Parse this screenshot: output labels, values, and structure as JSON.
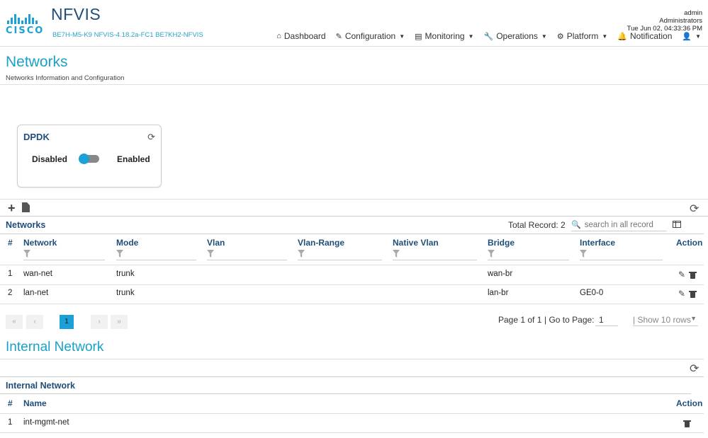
{
  "brand": {
    "logo_text": "cisco",
    "app_title": "NFVIS",
    "app_subtitle": "BE7H-M5-K9 NFVIS-4.18.2a-FC1 BE7KH2-NFVIS"
  },
  "user": {
    "name": "admin",
    "role": "Administrators",
    "datetime": "Tue Jun 02, 04:33:36 PM"
  },
  "nav": {
    "dashboard": "Dashboard",
    "configuration": "Configuration",
    "monitoring": "Monitoring",
    "operations": "Operations",
    "platform": "Platform",
    "notification": "Notification"
  },
  "page": {
    "title": "Networks",
    "description": "Networks Information and Configuration"
  },
  "dpdk": {
    "title": "DPDK",
    "disabled_label": "Disabled",
    "enabled_label": "Enabled",
    "state": "Disabled"
  },
  "networks": {
    "title": "Networks",
    "total_record": "Total Record: 2",
    "search_placeholder": "search in all record",
    "columns": {
      "num": "#",
      "network": "Network",
      "mode": "Mode",
      "vlan": "Vlan",
      "vlan_range": "Vlan-Range",
      "native_vlan": "Native Vlan",
      "bridge": "Bridge",
      "interface": "Interface",
      "action": "Action"
    },
    "rows": [
      {
        "num": "1",
        "network": "wan-net",
        "mode": "trunk",
        "vlan": "",
        "vlan_range": "",
        "native_vlan": "",
        "bridge": "wan-br",
        "interface": ""
      },
      {
        "num": "2",
        "network": "lan-net",
        "mode": "trunk",
        "vlan": "",
        "vlan_range": "",
        "native_vlan": "",
        "bridge": "lan-br",
        "interface": "GE0-0"
      }
    ],
    "pagination": {
      "first": "«",
      "prev": "‹",
      "current": "1",
      "next": "›",
      "last": "»",
      "page_info": "Page 1 of 1",
      "goto_label": "| Go to Page:",
      "goto_value": "1",
      "rows_label": "| Show 10 rows"
    }
  },
  "internal_network": {
    "heading": "Internal Network",
    "title": "Internal Network",
    "columns": {
      "num": "#",
      "name": "Name",
      "action": "Action"
    },
    "rows": [
      {
        "num": "1",
        "name": "int-mgmt-net"
      }
    ]
  },
  "colors": {
    "accent": "#1ba0d7",
    "heading": "#1f4e79"
  }
}
